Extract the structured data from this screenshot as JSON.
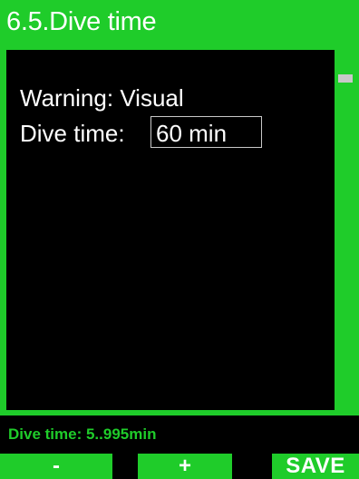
{
  "header": {
    "title": "6.5.Dive time"
  },
  "settings": {
    "warning_label": "Warning:",
    "warning_value": "Visual",
    "dive_time_label": "Dive time:",
    "dive_time_value": "60 min"
  },
  "hint": {
    "text": "Dive time: 5..995min"
  },
  "softkeys": {
    "left": "-",
    "middle": "+",
    "right": "SAVE"
  },
  "colors": {
    "accent": "#1fcc2a",
    "background": "#000000",
    "text": "#ffffff"
  }
}
